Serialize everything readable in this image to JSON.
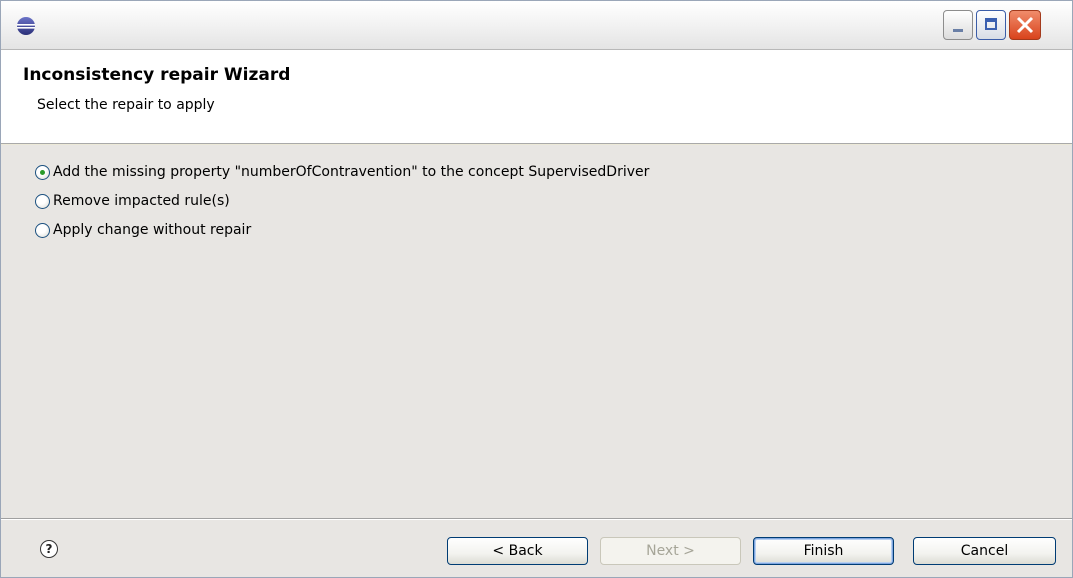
{
  "window": {
    "title": "",
    "icon": "eclipse-icon"
  },
  "titlebar": {
    "minimize_icon": "minimize-icon",
    "maximize_icon": "maximize-icon",
    "close_icon": "close-icon"
  },
  "header": {
    "title": "Inconsistency repair Wizard",
    "subtitle": "Select the repair to apply"
  },
  "options": [
    {
      "label": "Add the missing property \"numberOfContravention\" to the concept SupervisedDriver",
      "checked": true
    },
    {
      "label": "Remove impacted rule(s)",
      "checked": false
    },
    {
      "label": "Apply change without repair",
      "checked": false
    }
  ],
  "footer": {
    "help_glyph": "?",
    "back_label": "< Back",
    "next_label": "Next >",
    "finish_label": "Finish",
    "cancel_label": "Cancel"
  },
  "colors": {
    "radio_selected": "#2a9a2a",
    "close_button": "#d9431c"
  }
}
